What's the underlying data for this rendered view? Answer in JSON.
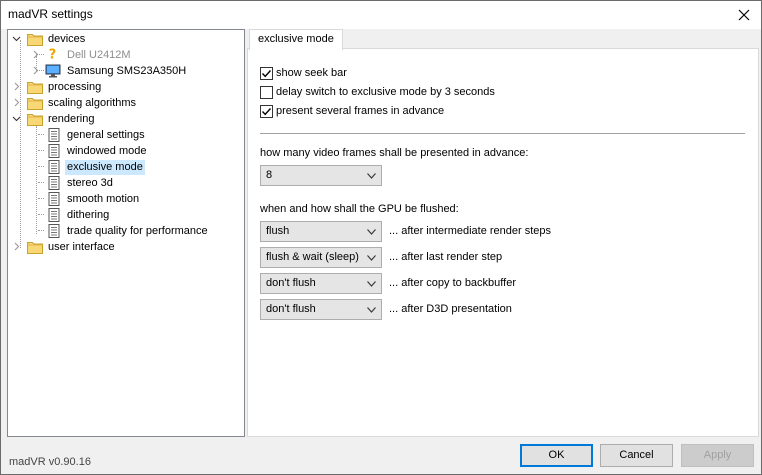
{
  "window": {
    "title": "madVR settings",
    "version": "madVR v0.90.16"
  },
  "tree": {
    "items": [
      {
        "label": "devices",
        "icon": "folder-icon",
        "expanded": true
      },
      {
        "label": "Dell U2412M",
        "icon": "question-monitor-icon",
        "disabled": true
      },
      {
        "label": "Samsung SMS23A350H",
        "icon": "monitor-icon"
      },
      {
        "label": "processing",
        "icon": "folder-icon"
      },
      {
        "label": "scaling algorithms",
        "icon": "folder-icon"
      },
      {
        "label": "rendering",
        "icon": "folder-icon",
        "expanded": true
      },
      {
        "label": "general settings",
        "icon": "page-icon"
      },
      {
        "label": "windowed mode",
        "icon": "page-icon"
      },
      {
        "label": "exclusive mode",
        "icon": "page-icon",
        "selected": true
      },
      {
        "label": "stereo 3d",
        "icon": "page-icon"
      },
      {
        "label": "smooth motion",
        "icon": "page-icon"
      },
      {
        "label": "dithering",
        "icon": "page-icon"
      },
      {
        "label": "trade quality for performance",
        "icon": "page-icon"
      },
      {
        "label": "user interface",
        "icon": "folder-icon"
      }
    ]
  },
  "tab": {
    "label": "exclusive mode"
  },
  "options": [
    {
      "label": "show seek bar",
      "checked": true
    },
    {
      "label": "delay switch to exclusive mode by 3 seconds",
      "checked": false
    },
    {
      "label": "present several frames in advance",
      "checked": true
    }
  ],
  "frames": {
    "label": "how many video frames shall be presented in advance:",
    "value": "8"
  },
  "flush": {
    "label": "when and how shall the GPU be flushed:",
    "rows": [
      {
        "value": "flush",
        "after": "... after intermediate render steps"
      },
      {
        "value": "flush & wait (sleep)",
        "after": "... after last render step"
      },
      {
        "value": "don't flush",
        "after": "... after copy to backbuffer"
      },
      {
        "value": "don't flush",
        "after": "... after D3D presentation"
      }
    ]
  },
  "buttons": {
    "ok": "OK",
    "cancel": "Cancel",
    "apply": "Apply"
  },
  "colors": {
    "selection": "#cce8ff",
    "default_button_border": "#0078d7",
    "folder": "#f5c542"
  }
}
